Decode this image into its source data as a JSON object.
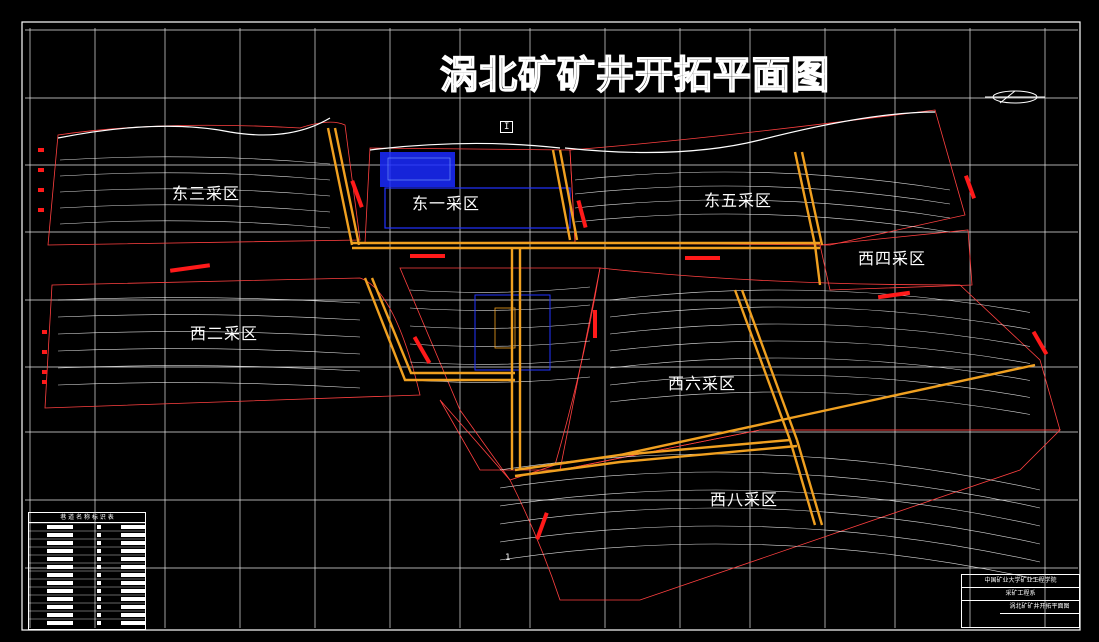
{
  "title": "涡北矿矿井开拓平面图",
  "zones": [
    {
      "id": "east3",
      "label": "东三采区"
    },
    {
      "id": "east1",
      "label": "东一采区"
    },
    {
      "id": "east5",
      "label": "东五采区"
    },
    {
      "id": "west4",
      "label": "西四采区"
    },
    {
      "id": "west2",
      "label": "西二采区"
    },
    {
      "id": "west6",
      "label": "西六采区"
    },
    {
      "id": "west8",
      "label": "西八采区"
    }
  ],
  "section_marks": {
    "top": "I",
    "bottom": "1"
  },
  "legend": {
    "header": "巷 道 名 称 标 识 表"
  },
  "title_block": {
    "institution": "中国矿业大学矿业工程学院",
    "dept": "采矿工程系",
    "drawing": "涡北矿矿井开拓平面图"
  },
  "colors": {
    "background": "#000000",
    "grid": "#ffffff",
    "boundary": "#ff3b3b",
    "roadway": "#f0a020",
    "facility": "#2233ff",
    "marker": "#ff1a1a"
  },
  "icons": {
    "north_arrow": "north-arrow-icon"
  }
}
